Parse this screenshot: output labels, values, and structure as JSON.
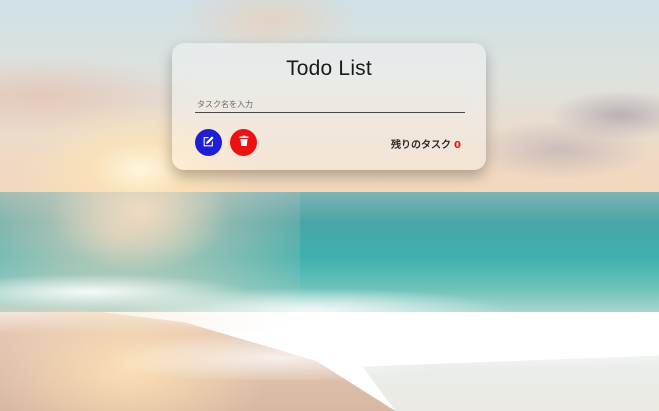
{
  "app": {
    "title": "Todo List"
  },
  "form": {
    "task_input_placeholder": "タスク名を入力",
    "task_input_value": ""
  },
  "actions": {
    "add_icon": "edit-icon",
    "add_color": "#1e1ed2",
    "delete_icon": "trash-icon",
    "delete_color": "#ee1111"
  },
  "status": {
    "remaining_label": "残りのタスク",
    "remaining_count": "0",
    "count_color": "#ee1111"
  }
}
